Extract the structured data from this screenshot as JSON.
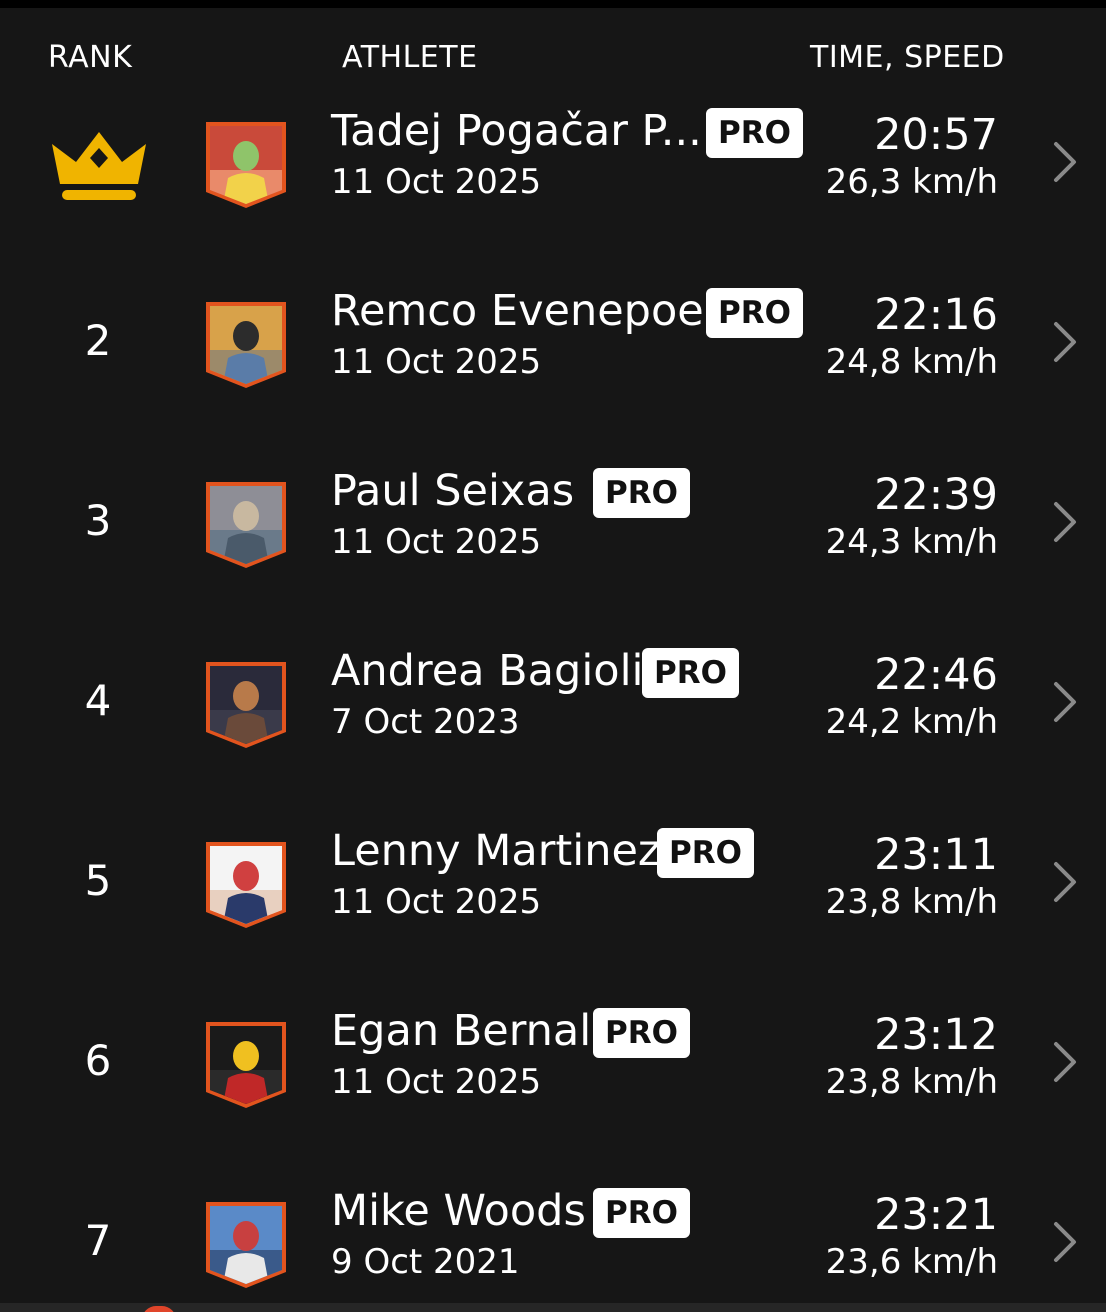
{
  "header": {
    "rank": "RANK",
    "athlete": "ATHLETE",
    "time_speed": "TIME, SPEED"
  },
  "colors": {
    "background": "#161616",
    "crown": "#f0b400",
    "avatar_border": "#e2541e",
    "badge_bg": "#ffffff",
    "chevron": "#8a8a8a"
  },
  "rows": [
    {
      "rank": "1",
      "rank_icon": "crown-icon",
      "name": "Tadej Pogačar P...",
      "badge": "PRO",
      "date": "11 Oct 2025",
      "time": "20:57",
      "speed": "26,3 km/h"
    },
    {
      "rank": "2",
      "name": "Remco Evenepoel",
      "badge": "PRO",
      "date": "11 Oct 2025",
      "time": "22:16",
      "speed": "24,8 km/h"
    },
    {
      "rank": "3",
      "name": "Paul  Seixas",
      "badge": "PRO",
      "date": "11 Oct 2025",
      "time": "22:39",
      "speed": "24,3 km/h"
    },
    {
      "rank": "4",
      "name": "Andrea Bagioli",
      "badge": "PRO",
      "date": "7 Oct 2023",
      "time": "22:46",
      "speed": "24,2 km/h"
    },
    {
      "rank": "5",
      "name": "Lenny Martinez",
      "badge": "PRO",
      "date": "11 Oct 2025",
      "time": "23:11",
      "speed": "23,8 km/h"
    },
    {
      "rank": "6",
      "name": "Egan Bernal",
      "badge": "PRO",
      "date": "11 Oct 2025",
      "time": "23:12",
      "speed": "23,8 km/h"
    },
    {
      "rank": "7",
      "name": "Mike Woods",
      "badge": "PRO",
      "date": "9 Oct 2021",
      "time": "23:21",
      "speed": "23,6 km/h"
    }
  ]
}
